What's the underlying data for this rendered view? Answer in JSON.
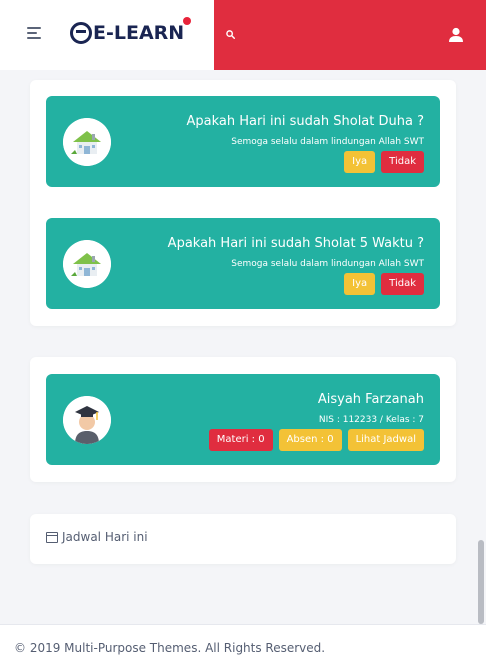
{
  "header": {
    "logo_text": "E-LEARN",
    "brand_color": "#e02d3f",
    "menu_icon": "menu-icon",
    "search_icon": "search-icon",
    "user_icon": "user-icon"
  },
  "prayer_cards": [
    {
      "title": "Apakah Hari ini sudah Sholat Duha ?",
      "subtitle": "Semoga selalu dalam lindungan Allah SWT",
      "yes_label": "Iya",
      "no_label": "Tidak"
    },
    {
      "title": "Apakah Hari ini sudah Sholat 5 Waktu ?",
      "subtitle": "Semoga selalu dalam lindungan Allah SWT",
      "yes_label": "Iya",
      "no_label": "Tidak"
    }
  ],
  "student": {
    "name": "Aisyah Farzanah",
    "info": "NIS : 112233 / Kelas : 7",
    "materi_label": "Materi : 0",
    "absen_label": "Absen : 0",
    "jadwal_label": "Lihat Jadwal"
  },
  "schedule": {
    "label": "Jadwal Hari ini"
  },
  "footer": {
    "text": "© 2019 Multi-Purpose Themes. All Rights Reserved."
  },
  "colors": {
    "card": "#23b1a2",
    "yes": "#f3c236",
    "no": "#e02d3f"
  }
}
